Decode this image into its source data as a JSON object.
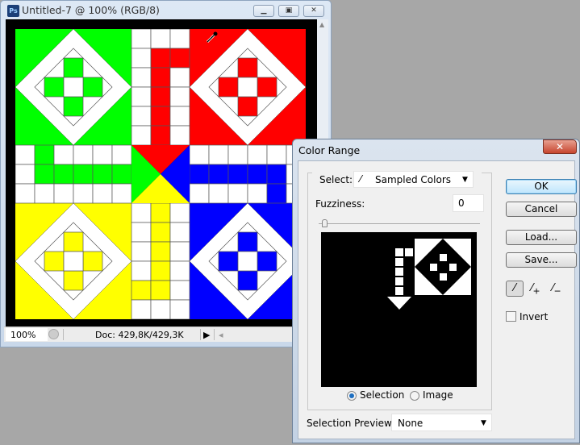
{
  "ps_window": {
    "app_icon": "Ps",
    "title": "Untitled-7 @ 100% (RGB/8)",
    "minimize_icon": "minimize-icon",
    "maximize_icon": "restore-icon",
    "close_icon": "close-icon",
    "status": {
      "zoom": "100%",
      "doc": "Doc: 429,8K/429,3K",
      "arrow": "▶",
      "scroll_left": "◂"
    },
    "board_colors": {
      "green": "#00ff00",
      "red": "#ff0000",
      "blue": "#0000ff",
      "yellow": "#ffff00",
      "grid": "#555555",
      "frame": "#000000"
    }
  },
  "dialog": {
    "title": "Color Range",
    "close": "✕",
    "select_label": "Select:",
    "select_value": "Sampled Colors",
    "fuzziness_label": "Fuzziness:",
    "fuzziness_value": "0",
    "fuzziness_slider": 0,
    "buttons": {
      "ok": "OK",
      "cancel": "Cancel",
      "load": "Load...",
      "save": "Save..."
    },
    "eyedroppers": [
      "eyedropper-icon",
      "eyedropper-plus-icon",
      "eyedropper-minus-icon"
    ],
    "invert_label": "Invert",
    "invert_checked": false,
    "radio_selection": "Selection",
    "radio_image": "Image",
    "radio_selected": "Selection",
    "preview_label": "Selection Preview:",
    "preview_value": "None"
  }
}
